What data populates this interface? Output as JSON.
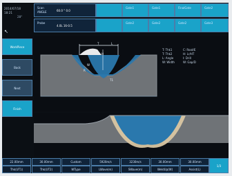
{
  "clock": {
    "date": "2014/07/18",
    "time": "18:21",
    "small": "28°",
    "cursor_glyph": "↖"
  },
  "header": {
    "row1": [
      {
        "key": "Scan",
        "key2": "ANGLE",
        "value": "60.0 ° 0.0"
      },
      {
        "key": "",
        "value": ""
      },
      {
        "key": "Gate1",
        "value": ""
      },
      {
        "key": "Gate1",
        "value": ""
      },
      {
        "key": "FinalGate",
        "value": ""
      },
      {
        "key": "Gate2",
        "value": ""
      }
    ],
    "row2": [
      {
        "key": "Probe",
        "value": "4.0L 16-0.5"
      },
      {
        "key": "",
        "value": ""
      },
      {
        "key": "Gate2",
        "value": ""
      },
      {
        "key": "Gate2",
        "value": ""
      },
      {
        "key": "Gate2",
        "value": ""
      },
      {
        "key": "Gate3",
        "value": ""
      }
    ]
  },
  "menu": [
    {
      "label": "WorkPiece",
      "active": true
    },
    {
      "label": "Back",
      "active": false
    },
    {
      "label": "Next",
      "active": false
    },
    {
      "label": "Finish",
      "active": true
    }
  ],
  "weld_labels": {
    "T": "T",
    "H": "H",
    "L": "L",
    "W": "W",
    "R": "R",
    "T1": "T1"
  },
  "params": {
    "left": [
      "T: Thk1",
      "T: Thk2",
      "L: Angle",
      "W: Width"
    ],
    "right": [
      "C: Root/E",
      "H: Lr/HT",
      "I: Drill",
      "W: Gap/D"
    ]
  },
  "bottom": {
    "row1": [
      "22.00mm",
      "30.00mm",
      "Custom",
      "5920m/s",
      "3230m/s",
      "30.00mm",
      "30.00mm"
    ],
    "row2": [
      "Thk(UT1)",
      "Thk(UT2)",
      "WType",
      "LWave(m)",
      "SWave(m)",
      "WeldUp(W)",
      "Assist(L)"
    ],
    "page": "1/3"
  },
  "colors": {
    "accent": "#1aa3c9",
    "panel": "#10243a",
    "steel": "#6f7377",
    "weld": "#2a78ad",
    "haz": "#d9c6a2"
  }
}
